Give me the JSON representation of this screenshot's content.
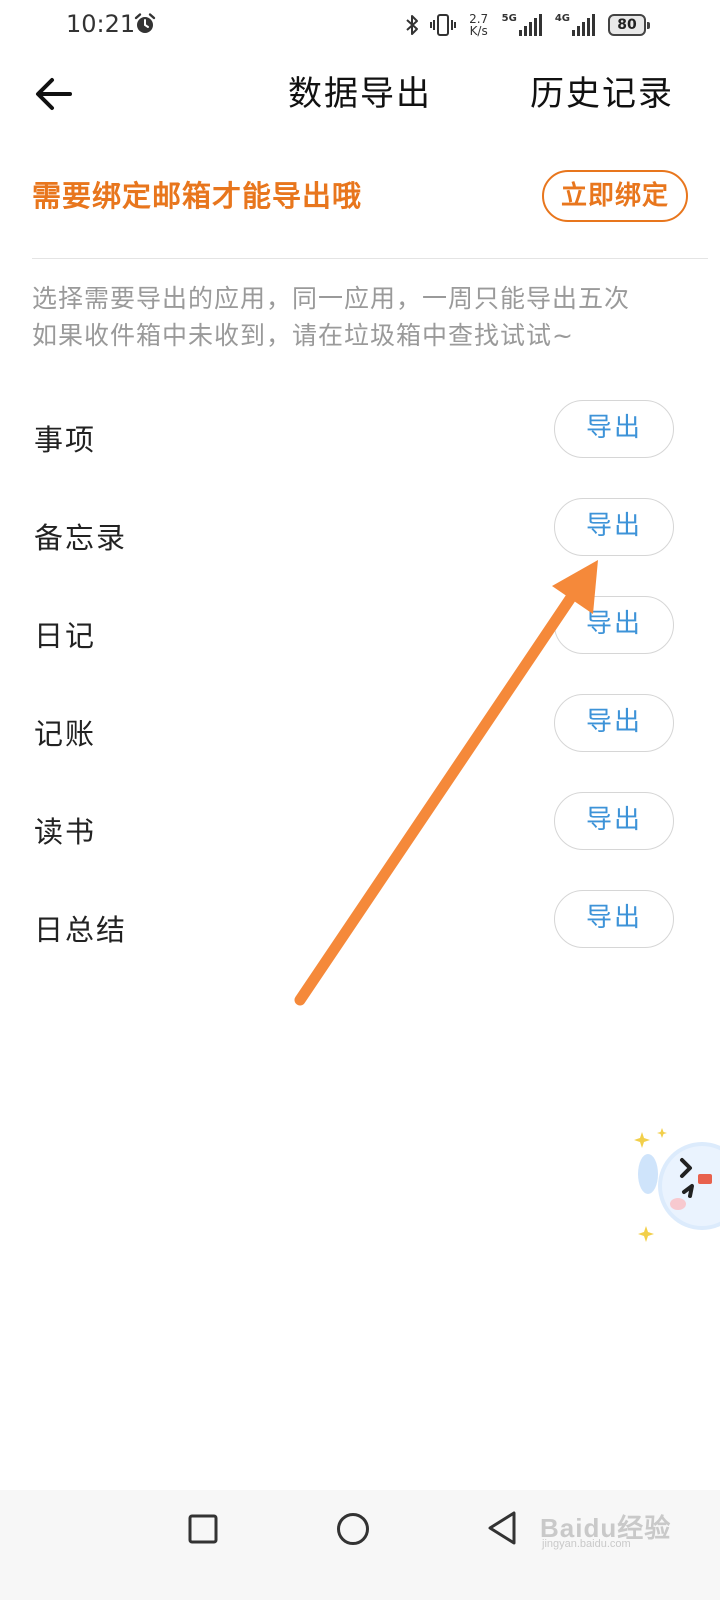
{
  "status_bar": {
    "time": "10:21",
    "net_speed_value": "2.7",
    "net_speed_unit": "K/s",
    "signal_1_label": "5G",
    "signal_2_label": "4G",
    "battery_level": "80",
    "icons": [
      "alarm-icon",
      "bluetooth-icon",
      "vibrate-icon",
      "signal-icon",
      "battery-icon"
    ]
  },
  "header": {
    "back_icon": "arrow-left-icon",
    "title": "数据导出",
    "history_label": "历史记录"
  },
  "bind_banner": {
    "tip": "需要绑定邮箱才能导出哦",
    "button_label": "立即绑定"
  },
  "notice": {
    "line1": "选择需要导出的应用，同一应用，一周只能导出五次",
    "line2": "如果收件箱中未收到，请在垃圾箱中查找试试~"
  },
  "export_items": [
    {
      "label": "事项",
      "button": "导出"
    },
    {
      "label": "备忘录",
      "button": "导出"
    },
    {
      "label": "日记",
      "button": "导出"
    },
    {
      "label": "记账",
      "button": "导出"
    },
    {
      "label": "读书",
      "button": "导出"
    },
    {
      "label": "日总结",
      "button": "导出"
    }
  ],
  "nav_bar": {
    "icons": [
      "recent-apps-icon",
      "home-icon",
      "back-icon"
    ]
  },
  "watermark": {
    "main": "Baidu经验",
    "sub": "jingyan.baidu.com"
  },
  "colors": {
    "accent_orange": "#e8761d",
    "button_blue": "#3d93d8",
    "annotation_arrow": "#f5893a",
    "hint_gray": "#9a9a9a"
  }
}
